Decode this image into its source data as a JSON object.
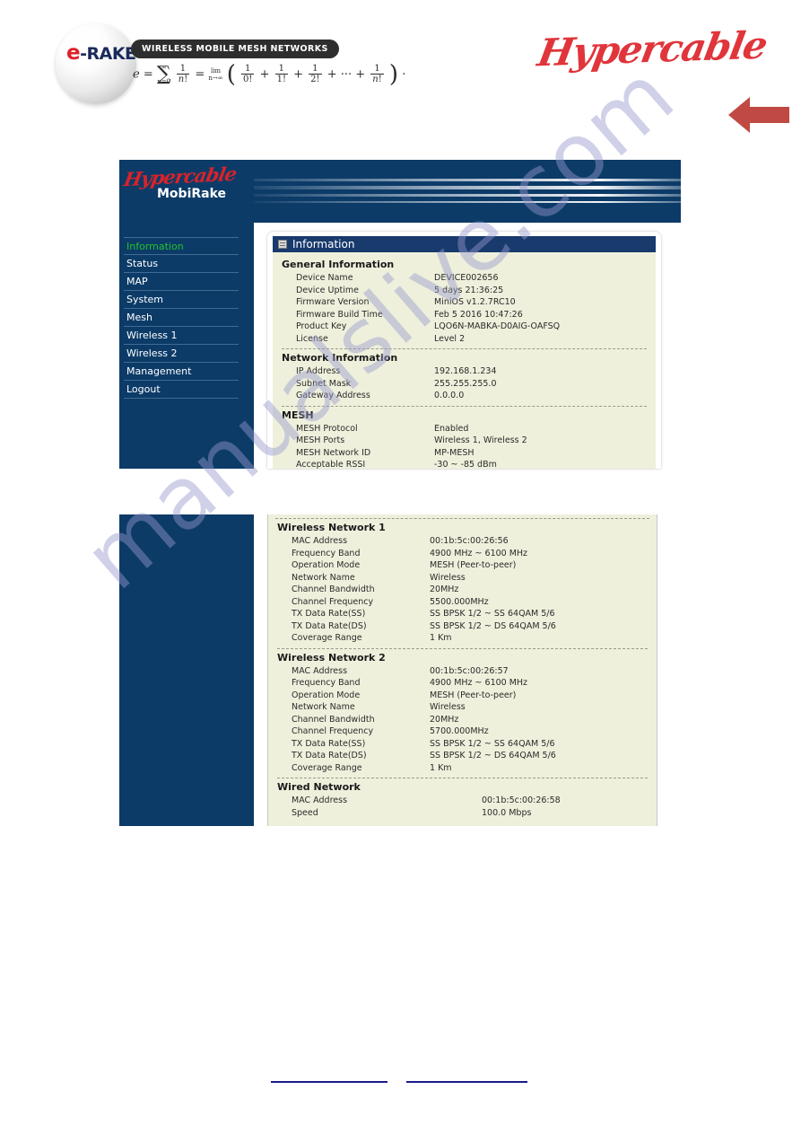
{
  "header": {
    "logo_text_e": "e",
    "logo_text_rest": "-RAKE",
    "tagline": "WIRELESS MOBILE MESH NETWORKS",
    "formula_label": "e = sum n=0..inf 1/n! = lim n->inf ( 1/0! + 1/1! + 1/2! + ... + 1/n! ) .",
    "company_logo": "Hypercable"
  },
  "arrow": {
    "color": "#c04a43",
    "direction": "left"
  },
  "screenshot_1": {
    "sidebar": {
      "brand_script": "Hypercable",
      "brand_model": "MobiRake",
      "items": [
        {
          "label": "Information",
          "active": true
        },
        {
          "label": "Status",
          "active": false
        },
        {
          "label": "MAP",
          "active": false
        },
        {
          "label": "System",
          "active": false
        },
        {
          "label": "Mesh",
          "active": false
        },
        {
          "label": "Wireless 1",
          "active": false
        },
        {
          "label": "Wireless 2",
          "active": false
        },
        {
          "label": "Management",
          "active": false
        },
        {
          "label": "Logout",
          "active": false
        }
      ]
    },
    "panel": {
      "title": "Information",
      "sections": [
        {
          "heading": "General Information",
          "rows": [
            {
              "key": "Device Name",
              "value": "DEVICE002656"
            },
            {
              "key": "Device Uptime",
              "value": "5 days 21:36:25"
            },
            {
              "key": "Firmware Version",
              "value": "MiniOS v1.2.7RC10"
            },
            {
              "key": "Firmware Build Time",
              "value": "Feb 5 2016 10:47:26"
            },
            {
              "key": "Product Key",
              "value": "LQO6N-MABKA-D0AIG-OAFSQ"
            },
            {
              "key": "License",
              "value": "Level 2"
            }
          ]
        },
        {
          "heading": "Network Information",
          "rows": [
            {
              "key": "IP Address",
              "value": "192.168.1.234"
            },
            {
              "key": "Subnet Mask",
              "value": "255.255.255.0"
            },
            {
              "key": "Gateway Address",
              "value": "0.0.0.0"
            }
          ]
        },
        {
          "heading": "MESH",
          "rows": [
            {
              "key": "MESH Protocol",
              "value": "Enabled"
            },
            {
              "key": "MESH Ports",
              "value": "Wireless 1, Wireless 2"
            },
            {
              "key": "MESH Network ID",
              "value": "MP-MESH"
            },
            {
              "key": "Acceptable RSSI",
              "value": "-30 ~ -85 dBm"
            }
          ]
        }
      ]
    }
  },
  "screenshot_2": {
    "sections": [
      {
        "heading": "Wireless Network 1",
        "rows": [
          {
            "key": "MAC Address",
            "value": "00:1b:5c:00:26:56"
          },
          {
            "key": "Frequency Band",
            "value": "4900 MHz ~ 6100 MHz"
          },
          {
            "key": "Operation Mode",
            "value": "MESH (Peer-to-peer)"
          },
          {
            "key": "Network Name",
            "value": "Wireless"
          },
          {
            "key": "Channel Bandwidth",
            "value": "20MHz"
          },
          {
            "key": "Channel Frequency",
            "value": "5500.000MHz"
          },
          {
            "key": "TX Data Rate(SS)",
            "value": "SS BPSK 1/2 ~ SS 64QAM 5/6"
          },
          {
            "key": "TX Data Rate(DS)",
            "value": "SS BPSK 1/2 ~ DS 64QAM 5/6"
          },
          {
            "key": "Coverage Range",
            "value": "1 Km"
          }
        ]
      },
      {
        "heading": "Wireless Network 2",
        "rows": [
          {
            "key": "MAC Address",
            "value": "00:1b:5c:00:26:57"
          },
          {
            "key": "Frequency Band",
            "value": "4900 MHz ~ 6100 MHz"
          },
          {
            "key": "Operation Mode",
            "value": "MESH (Peer-to-peer)"
          },
          {
            "key": "Network Name",
            "value": "Wireless"
          },
          {
            "key": "Channel Bandwidth",
            "value": "20MHz"
          },
          {
            "key": "Channel Frequency",
            "value": "5700.000MHz"
          },
          {
            "key": "TX Data Rate(SS)",
            "value": "SS BPSK 1/2 ~ SS 64QAM 5/6"
          },
          {
            "key": "TX Data Rate(DS)",
            "value": "SS BPSK 1/2 ~ DS 64QAM 5/6"
          },
          {
            "key": "Coverage Range",
            "value": "1 Km"
          }
        ]
      },
      {
        "heading": "Wired Network",
        "rows": [
          {
            "key": "MAC Address",
            "value": "00:1b:5c:00:26:58"
          },
          {
            "key": "Speed",
            "value": "100.0 Mbps"
          }
        ]
      }
    ]
  },
  "watermark": {
    "text": "manualslive.com"
  },
  "colors": {
    "navy": "#0c3b68",
    "panel_title": "#183a6d",
    "content_bg": "#eff0dc",
    "brand_red": "#d8232a",
    "active_green": "#22c12a",
    "arrow_red": "#c04a43",
    "footer_link": "#1a1a8c"
  }
}
